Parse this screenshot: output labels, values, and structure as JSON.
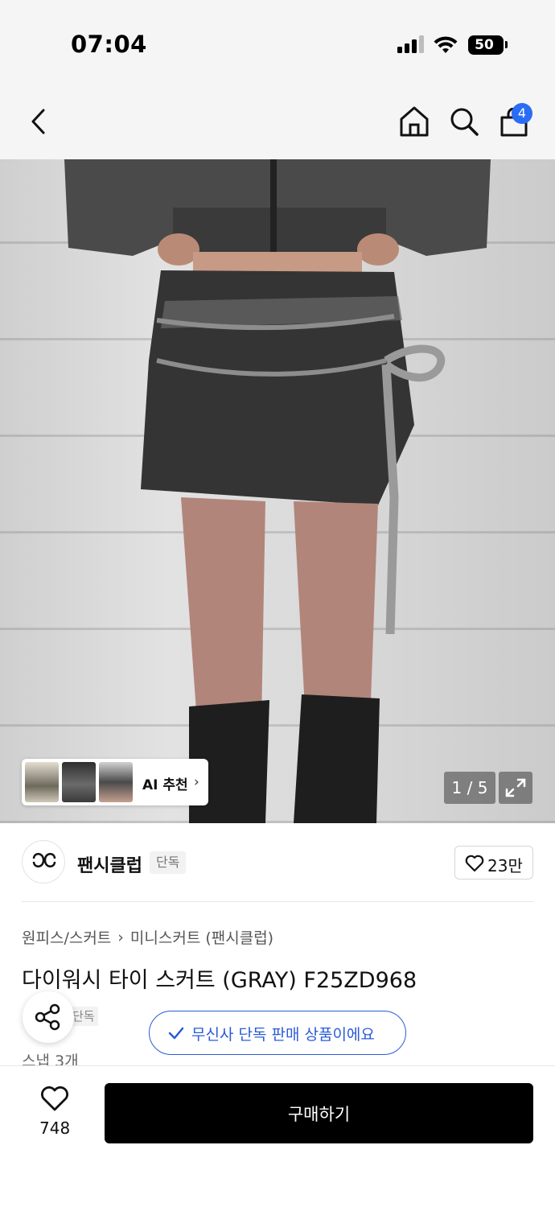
{
  "status_bar": {
    "time": "07:04",
    "battery": "50"
  },
  "nav": {
    "cart_count": "4",
    "icons": [
      "back-chevron-icon",
      "home-icon",
      "search-icon",
      "shopping-bag-icon"
    ]
  },
  "gallery": {
    "ai_recommend_label": "AI 추천",
    "page_indicator": "1 / 5",
    "current_page": 1,
    "total_pages": 5
  },
  "brand": {
    "name": "팬시클럽",
    "badge": "단독",
    "like_count": "23만"
  },
  "product": {
    "breadcrumb": [
      "원피스/스커트",
      "미니스커트 (팬시클럽)"
    ],
    "title": "다이워시 타이 스커트 (GRAY) F25ZD968",
    "tag_partial": "단독",
    "snap_count": "스냅 3개",
    "exclusive_notice": "무신사 단독 판매 상품이에요"
  },
  "bottom_bar": {
    "wish_count": "748",
    "buy_label": "구매하기"
  },
  "colors": {
    "accent_blue": "#2a5bd7",
    "badge_blue": "#2a6cf6",
    "buy_button": "#000000"
  }
}
